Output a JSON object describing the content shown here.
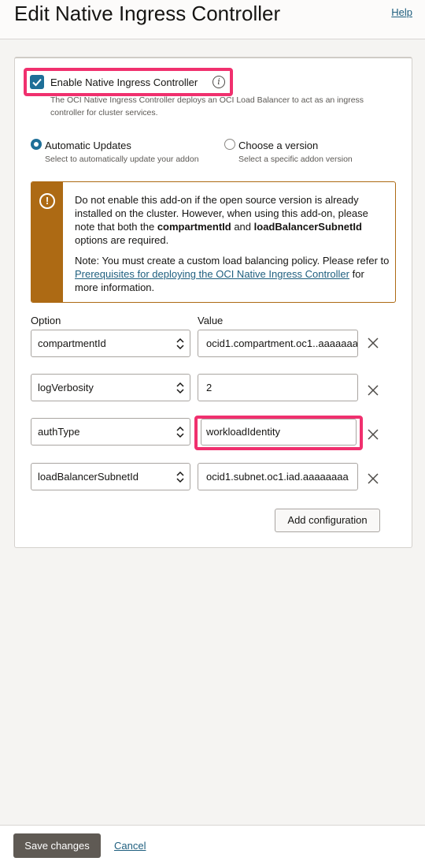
{
  "header": {
    "title": "Edit Native Ingress Controller",
    "help_label": "Help"
  },
  "enable": {
    "label": "Enable Native Ingress Controller",
    "checked": true,
    "info_icon": "info-icon",
    "description": "The OCI Native Ingress Controller deploys an OCI Load Balancer to act as an ingress controller for cluster services."
  },
  "updates": {
    "automatic": {
      "label": "Automatic Updates",
      "sub": "Select to automatically update your addon",
      "selected": true
    },
    "choose": {
      "label": "Choose a version",
      "sub": "Select a specific addon version",
      "selected": false
    }
  },
  "warning": {
    "icon": "exclamation-circle-icon",
    "p1_a": "Do not enable this add-on if the open source version is already installed on the cluster. However, when using this add-on, please note that both the ",
    "p1_b": "compartmentId",
    "p1_c": " and ",
    "p1_d": "loadBalancerSubnetId",
    "p1_e": " options are required.",
    "p2_a": "Note: You must create a custom load balancing policy. Please refer to ",
    "p2_link": "Prerequisites for deploying the OCI Native Ingress Controller",
    "p2_b": " for more information.",
    "color": "#ad6a14"
  },
  "config": {
    "option_header": "Option",
    "value_header": "Value",
    "rows": [
      {
        "option": "compartmentId",
        "value": "ocid1.compartment.oc1..aaaaaaa"
      },
      {
        "option": "logVerbosity",
        "value": "2"
      },
      {
        "option": "authType",
        "value": "workloadIdentity"
      },
      {
        "option": "loadBalancerSubnetId",
        "value": "ocid1.subnet.oc1.iad.aaaaaaaa"
      }
    ],
    "add_label": "Add configuration"
  },
  "footer": {
    "save_label": "Save changes",
    "cancel_label": "Cancel"
  },
  "colors": {
    "accent": "#1e6f98",
    "highlight": "#f0306e",
    "link": "#1f5f7f",
    "primary_button": "#5f5a54"
  }
}
